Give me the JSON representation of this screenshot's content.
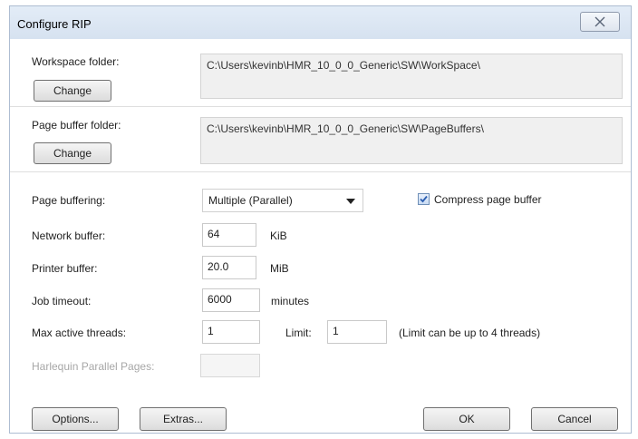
{
  "window": {
    "title": "Configure RIP",
    "close_icon": "close-icon"
  },
  "workspace": {
    "label": "Workspace folder:",
    "path": "C:\\Users\\kevinb\\HMR_10_0_0_Generic\\SW\\WorkSpace\\",
    "change_label": "Change"
  },
  "page_buffer_folder": {
    "label": "Page buffer folder:",
    "path": "C:\\Users\\kevinb\\HMR_10_0_0_Generic\\SW\\PageBuffers\\",
    "change_label": "Change"
  },
  "page_buffering": {
    "label": "Page buffering:",
    "selected": "Multiple (Parallel)"
  },
  "compress": {
    "label": "Compress page buffer",
    "checked": true
  },
  "network_buffer": {
    "label": "Network buffer:",
    "value": "64",
    "unit": "KiB"
  },
  "printer_buffer": {
    "label": "Printer buffer:",
    "value": "20.0",
    "unit": "MiB"
  },
  "job_timeout": {
    "label": "Job timeout:",
    "value": "6000",
    "unit": "minutes"
  },
  "threads": {
    "label": "Max active threads:",
    "value": "1",
    "limit_label": "Limit:",
    "limit_value": "1",
    "limit_note": "(Limit can be up to 4 threads)"
  },
  "parallel_pages": {
    "label": "Harlequin Parallel Pages:",
    "value": ""
  },
  "buttons": {
    "options": "Options...",
    "extras": "Extras...",
    "ok": "OK",
    "cancel": "Cancel"
  },
  "colors": {
    "titlebar": "#dce6f2",
    "checkbox_accent": "#2a5db0"
  }
}
